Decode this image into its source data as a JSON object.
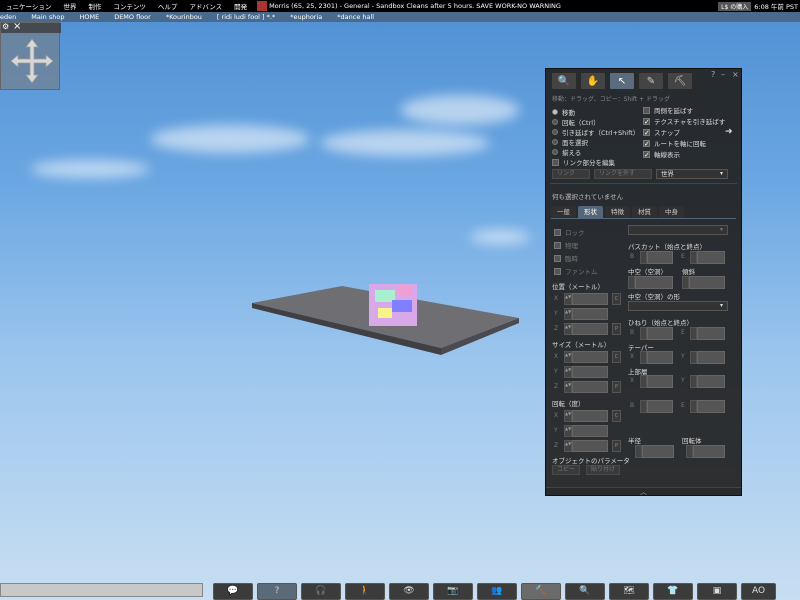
{
  "menu": {
    "items": [
      "ュニケーション",
      "世界",
      "制作",
      "コンテンツ",
      "ヘルプ",
      "アドバンス",
      "開発"
    ],
    "status": "Morris (65, 25, 2301) - General - Sandbox Cleans after 5 hours. SAVE WORK-NO WARNING",
    "l_button": "L$",
    "buy": "の購入",
    "time": "6:08 午前 PST"
  },
  "favorites": [
    "eden",
    "Main shop",
    "HOME",
    "DEMO floor",
    "*Kourinbou",
    "[ ridi ludi fool ] *.*",
    "*euphoria",
    "*dance hall"
  ],
  "build": {
    "controls": {
      "help": "?",
      "minimize": "–",
      "close": "×"
    },
    "tools": [
      {
        "icon": "magnifier-icon",
        "glyph": "🔍"
      },
      {
        "icon": "hand-icon",
        "glyph": "✋"
      },
      {
        "icon": "edit-arrow-icon",
        "glyph": "↖"
      },
      {
        "icon": "create-wand-icon",
        "glyph": "✎"
      },
      {
        "icon": "land-bulldozer-icon",
        "glyph": "⛏"
      }
    ],
    "hint": "移動：ドラッグ、コピー：Shift + ドラッグ",
    "modes": [
      "移動",
      "回転（Ctrl）",
      "引き延ばす（Ctrl+Shift）",
      "面を選択",
      "揃える",
      "リンク部分を編集"
    ],
    "options": [
      "両側を延ばす",
      "テクスチャを引き延ばす",
      "スナップ",
      "ルートを軸に回転",
      "軸線表示"
    ],
    "link": "リンク",
    "unlink": "リンクを外す",
    "ruler": "世界",
    "no_selection": "何も選択されていません",
    "tabs": [
      "一般",
      "形状",
      "特徴",
      "材質",
      "中身"
    ],
    "object": {
      "lock": "ロック",
      "physical": "物理",
      "temporary": "臨時",
      "phantom": "ファントム",
      "position": "位置（メートル）",
      "size": "サイズ（メートル）",
      "rotation": "回転（度）",
      "axes": [
        "X",
        "Y",
        "Z"
      ],
      "c_label": "C",
      "p_label": "P",
      "path_cut": "パスカット（始点と終点）",
      "hollow": "中空（空洞）",
      "skew": "傾斜",
      "hollow_shape": "中空（空洞）の形",
      "twist": "ひねり（始点と終点）",
      "taper": "テーパー",
      "top_shear": "上部層",
      "radius": "半径",
      "revolutions": "回転体",
      "b": "B",
      "e": "E",
      "params": "オブジェクトのパラメータ",
      "copy": "コピー",
      "paste": "貼り付け"
    }
  },
  "toolbar": {
    "buttons": [
      {
        "icon": "chat-icon",
        "glyph": "💬"
      },
      {
        "icon": "speak-icon",
        "glyph": "?"
      },
      {
        "icon": "headset-icon",
        "glyph": "🎧"
      },
      {
        "icon": "walk-icon",
        "glyph": "🚶"
      },
      {
        "icon": "eye-icon",
        "glyph": "👁"
      },
      {
        "icon": "camera-icon",
        "glyph": "📷"
      },
      {
        "icon": "people-icon",
        "glyph": "👥"
      },
      {
        "icon": "build-hammer-icon",
        "glyph": "🔨"
      },
      {
        "icon": "search-icon",
        "glyph": "🔍"
      },
      {
        "icon": "map-icon",
        "glyph": "🗺"
      },
      {
        "icon": "appearance-shirt-icon",
        "glyph": "👕"
      },
      {
        "icon": "inventory-box-icon",
        "glyph": "▣"
      },
      {
        "icon": "ao-label",
        "glyph": "AO"
      }
    ]
  }
}
